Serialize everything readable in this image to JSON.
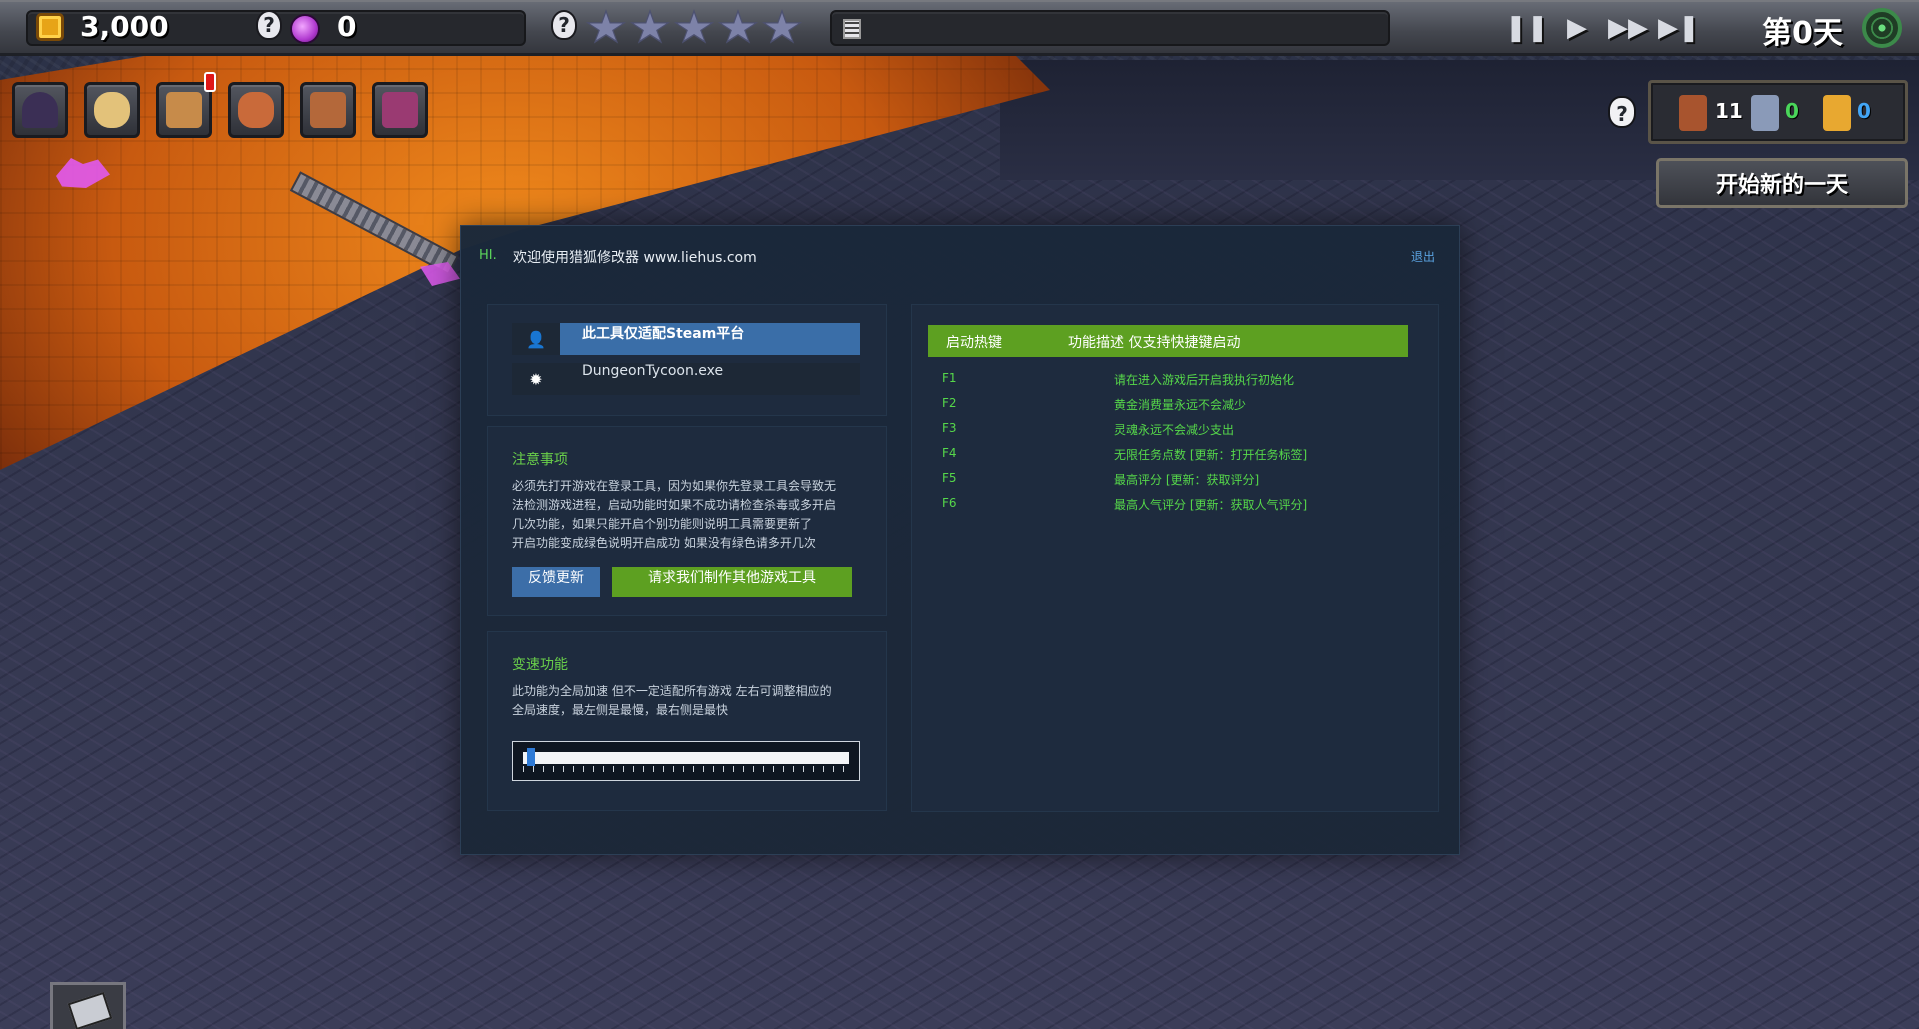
{
  "hud": {
    "gold": "3,000",
    "souls": "0",
    "rating_stars": 0,
    "rating_max": 5,
    "day": "第0天",
    "controls": {
      "pause": "❚❚",
      "play": "▶",
      "fast": "▶▶",
      "skip": "▶❚"
    },
    "icons": {
      "gold": "gold-coin-icon",
      "skull": "skull-hint-icon",
      "soul": "soul-orb-icon",
      "stars": "star-rating-icon",
      "list": "task-list-icon",
      "radar": "radar-icon"
    }
  },
  "toolbar": {
    "tools": [
      {
        "name": "portal-tool",
        "icon": "portal-icon",
        "color": "#3b2f55"
      },
      {
        "name": "monster-tool",
        "icon": "skull-icon",
        "color": "#e3c27a"
      },
      {
        "name": "book-tool",
        "icon": "book-icon",
        "color": "#c78b4a"
      },
      {
        "name": "craft-tool",
        "icon": "crafting-icon",
        "color": "#c96a3a"
      },
      {
        "name": "board-tool",
        "icon": "notice-board-icon",
        "color": "#b4683a"
      },
      {
        "name": "chest-tool",
        "icon": "chest-icon",
        "color": "#9a3a72"
      }
    ]
  },
  "resources": {
    "warriors": "11",
    "knights": "0",
    "heroes": "0",
    "warriors_color": "#a8542e",
    "knights_color": "#8a9ab8",
    "heroes_color": "#e8a830",
    "knights_text_color": "#4ad65a",
    "heroes_text_color": "#42a5f5",
    "help_glyph": "?",
    "skull_glyph": "?",
    "new_day_label": "开始新的一天"
  },
  "trainer": {
    "hi": "HI.",
    "title": "欢迎使用猎狐修改器 www.liehus.com",
    "exit": "退出",
    "platform_note": "此工具仅适配Steam平台",
    "process": "DungeonTycoon.exe",
    "user_glyph": "👤",
    "gear_glyph": "✹",
    "notice_title": "注意事项",
    "notice_lines": [
      "必须先打开游戏在登录工具，因为如果你先登录工具会导致无",
      "法检测游戏进程，启动功能时如果不成功请检查杀毒或多开启",
      "几次功能，如果只能开启个别功能则说明工具需要更新了",
      "开启功能变成绿色说明开启成功 如果没有绿色请多开几次"
    ],
    "feedback_btn": "反馈更新",
    "request_btn": "请求我们制作其他游戏工具",
    "speed_title": "变速功能",
    "speed_lines": [
      "此功能为全局加速 但不一定适配所有游戏 左右可调整相应的",
      "全局速度，最左侧是最慢，最右侧是最快"
    ],
    "speed_value": 0.02,
    "hotkey_header": "启动热键",
    "desc_header": "功能描述 仅支持快捷键启动",
    "hotkeys": [
      {
        "key": "F1",
        "desc": "请在进入游戏后开启我执行初始化"
      },
      {
        "key": "F2",
        "desc": "黄金消费量永远不会减少"
      },
      {
        "key": "F3",
        "desc": "灵魂永远不会减少支出"
      },
      {
        "key": "F4",
        "desc": "无限任务点数 [更新：打开任务标签]"
      },
      {
        "key": "F5",
        "desc": "最高评分 [更新：获取评分]"
      },
      {
        "key": "F6",
        "desc": "最高人气评分 [更新：获取人气评分]"
      }
    ],
    "accent_green": "#5da021",
    "accent_blue": "#3a6ea8"
  }
}
